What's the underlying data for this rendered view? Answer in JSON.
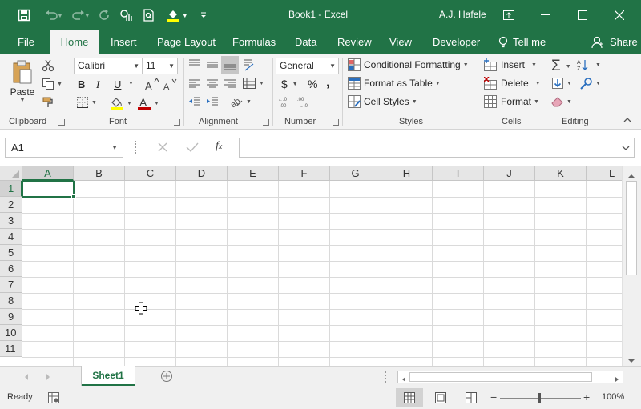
{
  "window": {
    "title": "Book1  -  Excel",
    "user": "A.J. Hafele"
  },
  "quick_access": [
    "save-icon",
    "undo-icon",
    "redo-icon",
    "repeat-icon",
    "touch-mode-icon",
    "print-preview-icon",
    "fill-color-icon",
    "customize-qat-icon"
  ],
  "tabs": [
    {
      "label": "File"
    },
    {
      "label": "Home"
    },
    {
      "label": "Insert"
    },
    {
      "label": "Page Layout"
    },
    {
      "label": "Formulas"
    },
    {
      "label": "Data"
    },
    {
      "label": "Review"
    },
    {
      "label": "View"
    },
    {
      "label": "Developer"
    },
    {
      "label": "Tell me"
    },
    {
      "label": "Share"
    }
  ],
  "ribbon": {
    "clipboard": {
      "label": "Clipboard",
      "paste": "Paste"
    },
    "font": {
      "label": "Font",
      "name": "Calibri",
      "size": "11",
      "bold": "B",
      "italic": "I",
      "underline": "U"
    },
    "alignment": {
      "label": "Alignment"
    },
    "number": {
      "label": "Number",
      "format": "General",
      "currency": "$",
      "percent": "%",
      "comma": ","
    },
    "styles": {
      "label": "Styles",
      "conditional": "Conditional Formatting",
      "table": "Format as Table",
      "cell_styles": "Cell Styles"
    },
    "cells": {
      "label": "Cells",
      "insert": "Insert",
      "delete": "Delete",
      "format": "Format"
    },
    "editing": {
      "label": "Editing"
    }
  },
  "formula_bar": {
    "name_box": "A1",
    "value": ""
  },
  "grid": {
    "columns": [
      "A",
      "B",
      "C",
      "D",
      "E",
      "F",
      "G",
      "H",
      "I",
      "J",
      "K",
      "L"
    ],
    "rows": [
      "1",
      "2",
      "3",
      "4",
      "5",
      "6",
      "7",
      "8",
      "9",
      "10",
      "11"
    ],
    "active_cell": "A1"
  },
  "sheets": [
    {
      "label": "Sheet1"
    }
  ],
  "status": {
    "text": "Ready",
    "zoom": "100%"
  },
  "colors": {
    "accent": "#217346"
  }
}
